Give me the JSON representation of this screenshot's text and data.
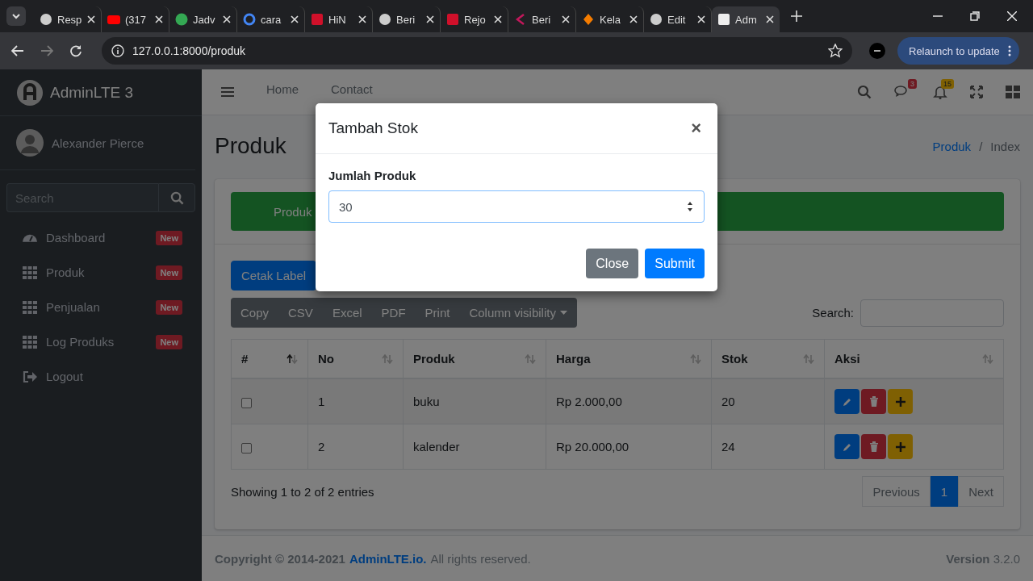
{
  "browser": {
    "tabs": [
      {
        "title": "Resp",
        "kind": "globe",
        "selected": false
      },
      {
        "title": "(317",
        "kind": "play",
        "selected": false
      },
      {
        "title": "Jadv",
        "kind": "plus",
        "selected": false
      },
      {
        "title": "cara",
        "kind": "ring",
        "selected": false
      },
      {
        "title": "HiN",
        "kind": "square",
        "selected": false
      },
      {
        "title": "Beri",
        "kind": "globe",
        "selected": false
      },
      {
        "title": "Rejo",
        "kind": "square",
        "selected": false
      },
      {
        "title": "Beri",
        "kind": "chevron",
        "selected": false
      },
      {
        "title": "Kela",
        "kind": "diamond",
        "selected": false
      },
      {
        "title": "Edit",
        "kind": "globe",
        "selected": false
      },
      {
        "title": "Adm",
        "kind": "square",
        "selected": true
      }
    ],
    "url": "127.0.0.1:8000/produk",
    "relaunch": "Relaunch to update"
  },
  "sidebar": {
    "brand": "AdminLTE 3",
    "user": "Alexander Pierce",
    "search_placeholder": "Search",
    "items": [
      {
        "label": "Dashboard",
        "kind": "gauge",
        "badge": "New"
      },
      {
        "label": "Produk",
        "kind": "grid",
        "badge": "New"
      },
      {
        "label": "Penjualan",
        "kind": "grid",
        "badge": "New"
      },
      {
        "label": "Log Produks",
        "kind": "grid",
        "badge": "New"
      },
      {
        "label": "Logout",
        "kind": "logout"
      }
    ]
  },
  "navbar": {
    "links": [
      "Home",
      "Contact"
    ],
    "messages_badge": "3",
    "notifications_badge": "15"
  },
  "page": {
    "title": "Produk",
    "breadcrumb": [
      "Produk",
      "Index"
    ],
    "breadcrumb_separator": "/"
  },
  "alert": "Produk",
  "print_button": "Cetak Label",
  "export_buttons": [
    "Copy",
    "CSV",
    "Excel",
    "PDF",
    "Print"
  ],
  "column_visibility": "Column visibility",
  "search_label": "Search:",
  "table": {
    "columns": [
      {
        "label": "#",
        "sorted": true
      },
      {
        "label": "No",
        "sorted": false
      },
      {
        "label": "Produk",
        "sorted": false
      },
      {
        "label": "Harga",
        "sorted": false
      },
      {
        "label": "Stok",
        "sorted": false
      },
      {
        "label": "Aksi",
        "sorted": false
      }
    ],
    "rows": [
      {
        "checked": false,
        "no": "1",
        "produk": "buku",
        "harga": "Rp 2.000,00",
        "stok": "20"
      },
      {
        "checked": false,
        "no": "2",
        "produk": "kalender",
        "harga": "Rp 20.000,00",
        "stok": "24"
      }
    ]
  },
  "info": "Showing 1 to 2 of 2 entries",
  "pagination": {
    "previous": "Previous",
    "pages": [
      {
        "label": "1",
        "selected": true
      }
    ],
    "next": "Next"
  },
  "footer": {
    "copyright": "Copyright © 2014-2021",
    "link": "AdminLTE.io.",
    "rest": "All rights reserved.",
    "version": "**Version** 3.2.0"
  },
  "modal": {
    "title": "Tambah Stok",
    "close": "×",
    "label": "Jumlah Produk",
    "value": "30",
    "buttons": [
      {
        "label": "Close",
        "kind": "secondary"
      },
      {
        "label": "Submit",
        "kind": "primary"
      }
    ]
  }
}
